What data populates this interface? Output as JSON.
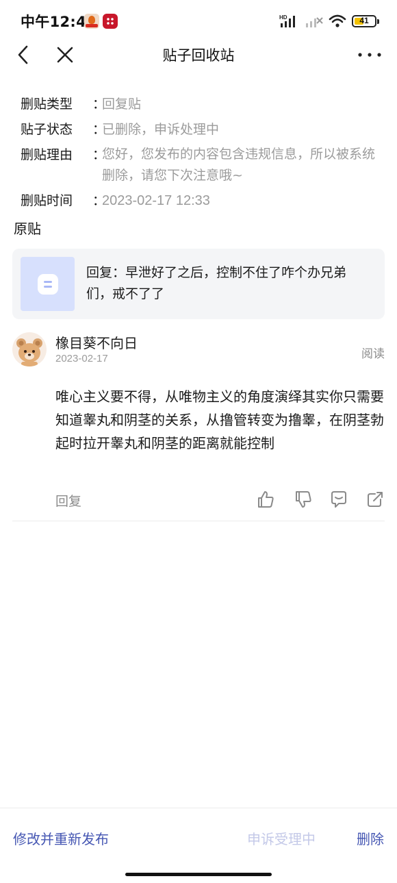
{
  "status_bar": {
    "time": "中午12:46",
    "battery": "41",
    "network_label": "HD"
  },
  "nav": {
    "title": "贴子回收站"
  },
  "info": {
    "type_label": "删贴类型",
    "type_value": "回复贴",
    "status_label": "贴子状态",
    "status_value": "已删除，申诉处理中",
    "reason_label": "删贴理由",
    "reason_value": "您好，您发布的内容包含违规信息，所以被系统删除，请您下次注意哦~",
    "time_label": "删贴时间",
    "time_value": "2023-02-17 12:33",
    "separator": "："
  },
  "original": {
    "section_title": "原贴",
    "text": "回复：早泄好了之后，控制不住了咋个办兄弟们，戒不了了"
  },
  "reply": {
    "username": "橡目葵不向日",
    "date": "2023-02-17",
    "read_label": "阅读",
    "content": " 唯心主义要不得，从唯物主义的角度演绎其实你只需要知道睾丸和阴茎的关系，从撸管转变为撸睾，在阴茎勃起时拉开睾丸和阴茎的距离就能控制",
    "reply_label": "回复"
  },
  "bottom": {
    "repost_label": "修改并重新发布",
    "appeal_label": "申诉受理中",
    "delete_label": "删除"
  },
  "colors": {
    "accent": "#4657b3",
    "accent_disabled": "#c4c9e8",
    "secondary_text": "#9b9b9b",
    "card_bg": "#f4f5f7",
    "thumb_bg": "#d7e0fd"
  }
}
